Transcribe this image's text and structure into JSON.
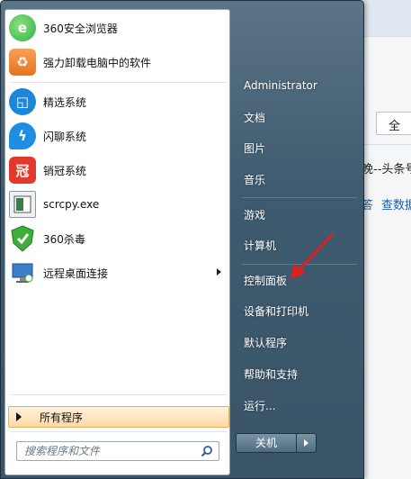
{
  "background_window": {
    "field_text": "全",
    "headline_text": "晚--头条号",
    "link_left": "答",
    "link_right": "查数据"
  },
  "pinned_programs": [
    {
      "label": "360安全浏览器",
      "icon": "360-browser-icon",
      "color": "#2bb24c"
    },
    {
      "label": "强力卸载电脑中的软件",
      "icon": "uninstall-icon",
      "color": "#e8731c"
    }
  ],
  "recent_programs": [
    {
      "label": "精选系统",
      "icon": "jingxuan-icon",
      "color": "#1c86d8"
    },
    {
      "label": "闪聊系统",
      "icon": "shanliao-icon",
      "color": "#1e8fe0"
    },
    {
      "label": "销冠系统",
      "icon": "xiaoguan-icon",
      "color": "#e3382b"
    },
    {
      "label": "scrcpy.exe",
      "icon": "scrcpy-icon",
      "color": "#3b7d4a"
    },
    {
      "label": "360杀毒",
      "icon": "360-antivirus-icon",
      "color": "#3fae3a"
    },
    {
      "label": "远程桌面连接",
      "icon": "remote-desktop-icon",
      "color": "#3a7fc8"
    }
  ],
  "all_programs_label": "所有程序",
  "search": {
    "placeholder": "搜索程序和文件"
  },
  "right_pane": [
    {
      "label": "Administrator",
      "name": "user-folder"
    },
    {
      "label": "文档",
      "name": "documents"
    },
    {
      "label": "图片",
      "name": "pictures"
    },
    {
      "label": "音乐",
      "name": "music"
    },
    {
      "label": "游戏",
      "name": "games"
    },
    {
      "label": "计算机",
      "name": "computer"
    },
    {
      "label": "控制面板",
      "name": "control-panel"
    },
    {
      "label": "设备和打印机",
      "name": "devices-printers"
    },
    {
      "label": "默认程序",
      "name": "default-programs"
    },
    {
      "label": "帮助和支持",
      "name": "help-support"
    },
    {
      "label": "运行...",
      "name": "run"
    }
  ],
  "shutdown_label": "关机",
  "colors": {
    "annotation_arrow": "#e0201a",
    "all_programs_highlight": "#fcd9a4"
  }
}
